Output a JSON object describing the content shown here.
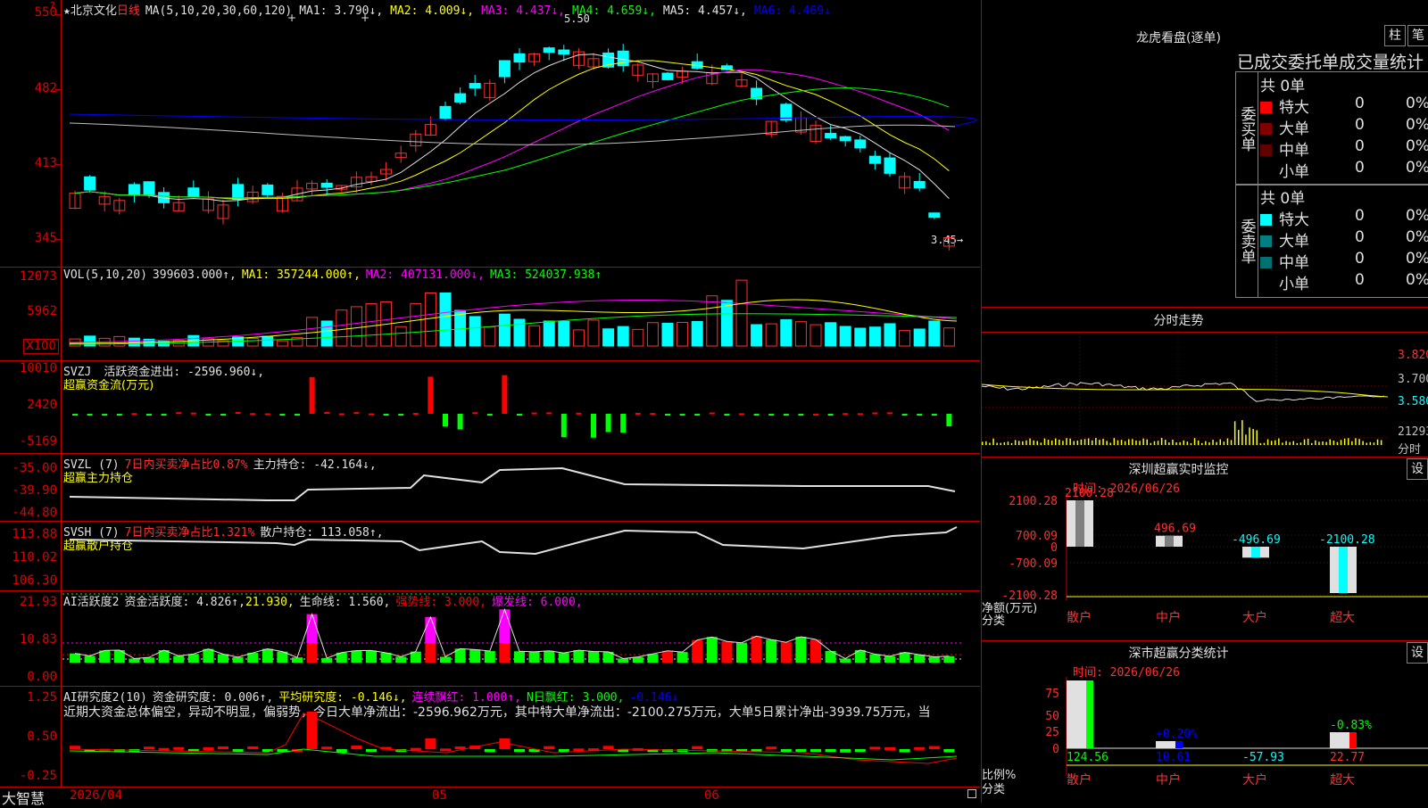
{
  "main_header": {
    "star": "★",
    "name": "北京文化",
    "period": "日线",
    "ma_label": "MA(5,10,20,30,60,120)",
    "ma1": "MA1: 3.790↓,",
    "ma2": "MA2: 4.009↓,",
    "ma3": "MA3: 4.437↓,",
    "ma4": "MA4: 4.659↓,",
    "ma5": "MA5: 4.457↓,",
    "ma6": "MA6: 4.469↓",
    "high_marker": "5.50",
    "low_marker": "3.45→",
    "y_labels": [
      "550",
      "482",
      "413",
      "345"
    ]
  },
  "vol_header": {
    "label": "VOL(5,10,20)",
    "value": "399603.000↑,",
    "ma1": "MA1: 357244.000↑,",
    "ma2": "MA2: 407131.000↓,",
    "ma3": "MA3: 524037.938↑",
    "y_labels": [
      "12073",
      "5962"
    ],
    "unit": "X100"
  },
  "svzj": {
    "label": "SVZJ",
    "title": "活跃资金进出: -2596.960↓,",
    "sub": "超赢资金流(万元)",
    "y_labels": [
      "10010",
      "2420",
      "-5169"
    ]
  },
  "svzl": {
    "label": "SVZL (7)",
    "t1": "7日内买卖净占比0.87%",
    "t2": "主力持仓: -42.164↓,",
    "sub": "超赢主力持仓",
    "y_labels": [
      "-35.00",
      "-39.90",
      "-44.80"
    ]
  },
  "svsh": {
    "label": "SVSH (7)",
    "t1": "7日内买卖净占比1.321%",
    "t2": "散户持仓: 113.058↑,",
    "sub": "超赢散户持仓",
    "y_labels": [
      "113.88",
      "110.02",
      "106.30"
    ]
  },
  "ai1": {
    "label": "AI活跃度2",
    "t1": "资金活跃度: 4.826↑,",
    "t2": "21.930,",
    "t3": "生命线: 1.560,",
    "t4": "强势线: 3.000,",
    "t5": "爆发线: 6.000,",
    "y_labels": [
      "21.93",
      "10.83",
      "0.00"
    ]
  },
  "ai2": {
    "label": "AI研究度2(10)",
    "t1": "资金研究度: 0.006↑,",
    "t2": "平均研究度: -0.146↓,",
    "t3": "连续飘红: 1.000↑,",
    "t4": "N日飘红: 3.000,",
    "t5": "-0.146↓",
    "comment": "近期大资金总体偏空，异动不明显，偏弱势，今日大单净流出：-2596.962万元，其中特大单净流出：-2100.275万元，大单5日累计净出-3939.75万元，当",
    "y_labels": [
      "1.25",
      "0.50",
      "-0.25"
    ]
  },
  "x_axis": {
    "brand": "大智慧",
    "labels": [
      "2026/04",
      "05",
      "06"
    ]
  },
  "longhu": {
    "title": "龙虎看盘(逐单)",
    "btn1": "柱",
    "btn2": "笔",
    "subtitle": "已成交委托单成交量统计",
    "buy_label": "委买单",
    "sell_label": "委卖单",
    "buy_total": "共 0单",
    "sell_total": "共 0单",
    "buy_rows": [
      {
        "name": "特大",
        "count": "0",
        "pct": "0%",
        "color": "#ff0000"
      },
      {
        "name": "大单",
        "count": "0",
        "pct": "0%",
        "color": "#800000"
      },
      {
        "name": "中单",
        "count": "0",
        "pct": "0%",
        "color": "#600000"
      },
      {
        "name": "小单",
        "count": "0",
        "pct": "0%",
        "color": "#000000"
      }
    ],
    "sell_rows": [
      {
        "name": "特大",
        "count": "0",
        "pct": "0%",
        "color": "#00ffff"
      },
      {
        "name": "大单",
        "count": "0",
        "pct": "0%",
        "color": "#008080"
      },
      {
        "name": "中单",
        "count": "0",
        "pct": "0%",
        "color": "#007070"
      },
      {
        "name": "小单",
        "count": "0",
        "pct": "0%",
        "color": "#000000"
      }
    ]
  },
  "intraday": {
    "title": "分时走势",
    "prices": [
      "3.820",
      "3.700",
      "3.580"
    ],
    "vol_label": "21293",
    "vol_unit": "分时"
  },
  "sz_monitor": {
    "title": "深圳超赢实时监控",
    "btn": "设",
    "time": "时间: 2026/06/26",
    "y_labels": [
      "2100.28",
      "700.09",
      "0",
      "-700.09",
      "-2100.28"
    ],
    "axis_name": "净额(万元)",
    "axis_cat": "分类",
    "categories": [
      "散户",
      "中户",
      "大户",
      "超大"
    ],
    "values": [
      "2100.28",
      "496.69",
      "-496.69",
      "-2100.28"
    ]
  },
  "sz_class": {
    "title": "深市超赢分类统计",
    "btn": "设",
    "time": "时间: 2026/06/26",
    "y_labels": [
      "75",
      "50",
      "25",
      "0"
    ],
    "axis_name": "比例%",
    "axis_cat": "分类",
    "categories": [
      "散户",
      "中户",
      "大户",
      "超大"
    ],
    "pct_labels": [
      "",
      "+0.20%",
      "",
      "-0.83%"
    ],
    "values": [
      "124.56",
      "10.61",
      "-57.93",
      "22.77"
    ]
  }
}
